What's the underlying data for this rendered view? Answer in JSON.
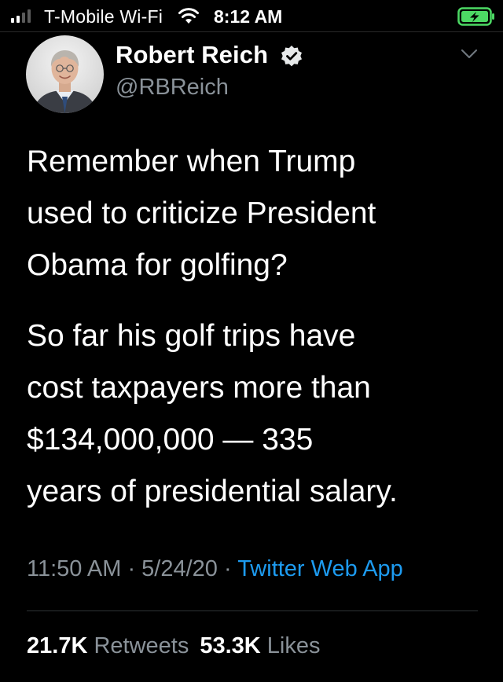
{
  "status_bar": {
    "carrier": "T-Mobile Wi-Fi",
    "time": "8:12 AM",
    "signal_bars": 4,
    "signal_bars_filled": 2,
    "wifi_icon": "wifi-icon",
    "battery_icon": "battery-charging-icon",
    "battery_color": "#4cd964"
  },
  "tweet": {
    "author": {
      "name": "Robert Reich",
      "handle": "@RBReich",
      "verified": true
    },
    "lines_paragraph_1": [
      "Remember when Trump",
      "used to criticize President",
      "Obama for golfing?"
    ],
    "lines_paragraph_2": [
      "So far his golf trips have",
      "cost taxpayers more than",
      "$134,000,000 — 335",
      "years of presidential salary."
    ],
    "time": "11:50 AM",
    "separator": " · ",
    "date": "5/24/20",
    "source": "Twitter Web App",
    "source_color": "#1d9bf0",
    "retweets_count": "21.7K",
    "retweets_label": "Retweets",
    "likes_count": "53.3K",
    "likes_label": "Likes"
  }
}
